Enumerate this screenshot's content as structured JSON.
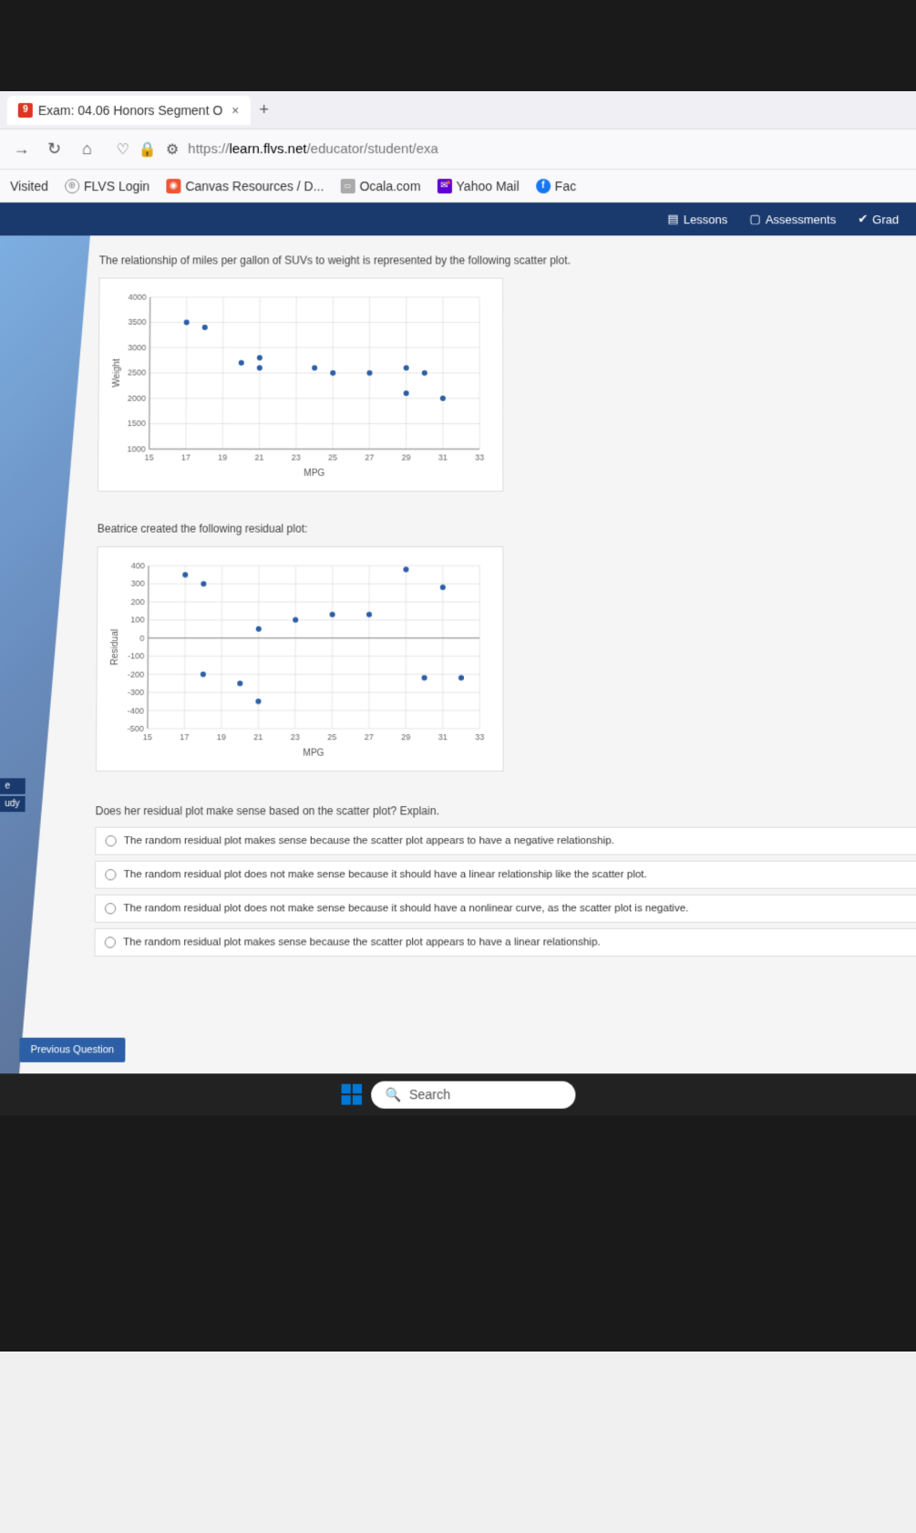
{
  "browser": {
    "tab_title": "Exam: 04.06 Honors Segment O",
    "url_prefix": "https://",
    "url_domain": "learn.flvs.net",
    "url_path": "/educator/student/exa"
  },
  "bookmarks": {
    "visited": "Visited",
    "flvs": "FLVS Login",
    "canvas": "Canvas Resources / D...",
    "ocala": "Ocala.com",
    "yahoo": "Yahoo Mail",
    "fb": "Fac"
  },
  "app_nav": {
    "lessons": "Lessons",
    "assessments": "Assessments",
    "grades": "Grad"
  },
  "question": {
    "intro": "The relationship of miles per gallon of SUVs to weight is represented by the following scatter plot.",
    "subtext": "Beatrice created the following residual plot:",
    "prompt": "Does her residual plot make sense based on the scatter plot? Explain."
  },
  "answers": [
    "The random residual plot makes sense because the scatter plot appears to have a negative relationship.",
    "The random residual plot does not make sense because it should have a linear relationship like the scatter plot.",
    "The random residual plot does not make sense because it should have a nonlinear curve, as the scatter plot is negative.",
    "The random residual plot makes sense because the scatter plot appears to have a linear relationship."
  ],
  "buttons": {
    "previous": "Previous Question"
  },
  "taskbar": {
    "search": "Search"
  },
  "side": {
    "e": "e",
    "udy": "udy"
  },
  "chart_data": [
    {
      "type": "scatter",
      "title": "",
      "xlabel": "MPG",
      "ylabel": "Weight",
      "xlim": [
        15,
        33
      ],
      "ylim": [
        1000,
        4000
      ],
      "xticks": [
        15,
        17,
        19,
        21,
        23,
        25,
        27,
        29,
        31,
        33
      ],
      "yticks": [
        1000,
        1500,
        2000,
        2500,
        3000,
        3500,
        4000
      ],
      "points": [
        {
          "x": 17,
          "y": 3500
        },
        {
          "x": 18,
          "y": 3400
        },
        {
          "x": 20,
          "y": 2700
        },
        {
          "x": 21,
          "y": 2800
        },
        {
          "x": 21,
          "y": 2600
        },
        {
          "x": 24,
          "y": 2600
        },
        {
          "x": 25,
          "y": 2500
        },
        {
          "x": 27,
          "y": 2500
        },
        {
          "x": 29,
          "y": 2600
        },
        {
          "x": 29,
          "y": 2100
        },
        {
          "x": 30,
          "y": 2500
        },
        {
          "x": 31,
          "y": 2000
        }
      ]
    },
    {
      "type": "scatter",
      "title": "",
      "xlabel": "MPG",
      "ylabel": "Residual",
      "xlim": [
        15,
        33
      ],
      "ylim": [
        -500,
        400
      ],
      "xticks": [
        15,
        17,
        19,
        21,
        23,
        25,
        27,
        29,
        31,
        33
      ],
      "yticks": [
        -500,
        -400,
        -300,
        -200,
        -100,
        0,
        100,
        200,
        300,
        400
      ],
      "points": [
        {
          "x": 17,
          "y": 350
        },
        {
          "x": 18,
          "y": 300
        },
        {
          "x": 18,
          "y": -200
        },
        {
          "x": 20,
          "y": -250
        },
        {
          "x": 21,
          "y": 50
        },
        {
          "x": 21,
          "y": -350
        },
        {
          "x": 23,
          "y": 100
        },
        {
          "x": 25,
          "y": 130
        },
        {
          "x": 27,
          "y": 130
        },
        {
          "x": 29,
          "y": 380
        },
        {
          "x": 30,
          "y": -220
        },
        {
          "x": 31,
          "y": 280
        },
        {
          "x": 32,
          "y": -220
        }
      ]
    }
  ]
}
